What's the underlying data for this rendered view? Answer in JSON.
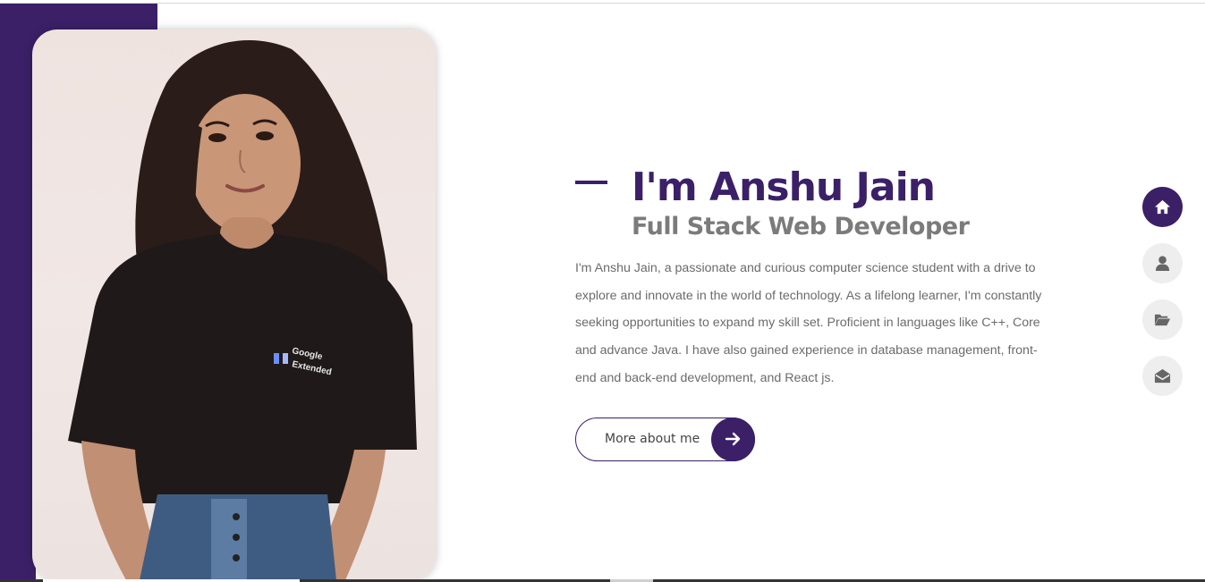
{
  "hero": {
    "title": "I'm Anshu Jain",
    "subtitle": "Full Stack Web Developer",
    "bio": "I'm Anshu Jain, a passionate and curious computer science student with a drive to explore and innovate in the world of technology. As a lifelong learner, I'm constantly seeking opportunities to expand my skill set. Proficient in languages like C++, Core and advance Java. I have also gained experience in database management, front-end and back-end development, and React js.",
    "cta_label": "More about me",
    "cta_icon": "arrow-right-icon",
    "portrait_shirt_text": [
      "Google",
      "Extended"
    ]
  },
  "side_nav": {
    "items": [
      {
        "icon": "home-icon",
        "active": true
      },
      {
        "icon": "user-icon",
        "active": false
      },
      {
        "icon": "folder-open-icon",
        "active": false
      },
      {
        "icon": "envelope-open-icon",
        "active": false
      }
    ]
  },
  "colors": {
    "accent": "#3b2068",
    "subtitle": "#7b7b7b",
    "body_text": "#6b6b6b",
    "nav_inactive": "#eeeeee",
    "nav_icon_inactive": "#666666"
  }
}
